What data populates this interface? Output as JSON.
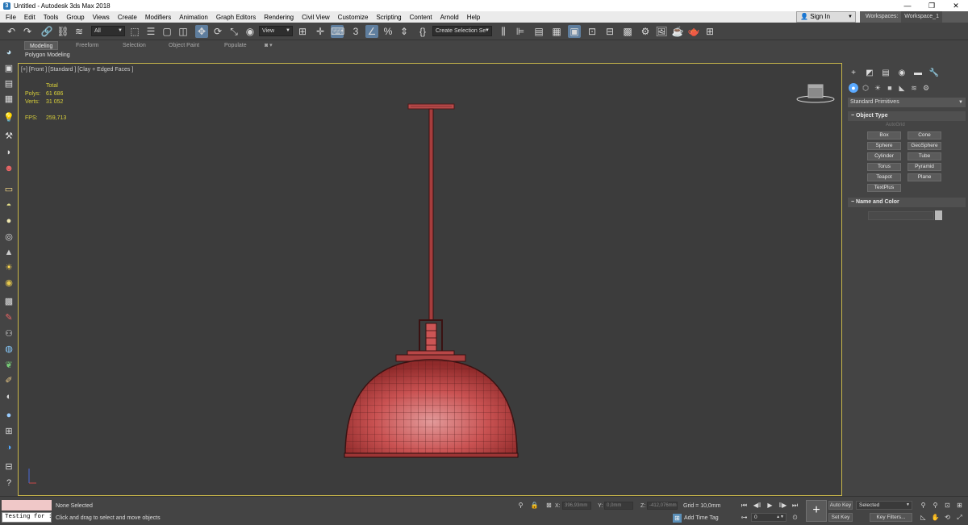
{
  "window": {
    "title": "Untitled - Autodesk 3ds Max 2018",
    "app_icon": "3ds-max-logo-icon",
    "controls": [
      "—",
      "❐",
      "✕"
    ]
  },
  "menubar": {
    "items": [
      "File",
      "Edit",
      "Tools",
      "Group",
      "Views",
      "Create",
      "Modifiers",
      "Animation",
      "Graph Editors",
      "Rendering",
      "Civil View",
      "Customize",
      "Scripting",
      "Content",
      "Arnold",
      "Help"
    ],
    "sign_in": "Sign In",
    "workspaces_label": "Workspaces:",
    "workspace_value": "Workspace_1"
  },
  "toolbar": {
    "selection_filter": "All",
    "reference_coord": "View",
    "named_selection": "Create Selection Se"
  },
  "ribbon": {
    "tabs": [
      "Modeling",
      "Freeform",
      "Selection",
      "Object Paint",
      "Populate"
    ],
    "active_tab": "Modeling",
    "sub_label": "Polygon Modeling"
  },
  "viewport": {
    "label": "[+] [Front ] [Standard ] [Clay + Edged Faces ]",
    "stats": {
      "total_label": "Total",
      "polys_label": "Polys:",
      "polys_value": "61 686",
      "verts_label": "Verts:",
      "verts_value": "31 052",
      "fps_label": "FPS:",
      "fps_value": "259,713"
    },
    "mesh_color": "#c04545",
    "border_color": "#c8b64a",
    "object": "pendant-lamp"
  },
  "command_panel": {
    "category": "Standard Primitives",
    "object_type_header": "Object Type",
    "autogrid_label": "AutoGrid",
    "buttons": [
      "Box",
      "Cone",
      "Sphere",
      "GeoSphere",
      "Cylinder",
      "Tube",
      "Torus",
      "Pyramid",
      "Teapot",
      "Plane",
      "TextPlus"
    ],
    "name_color_header": "Name and Color"
  },
  "statusbar": {
    "script_input": "Testing for :",
    "selection_status": "None Selected",
    "prompt": "Click and drag to select and move objects",
    "x_label": "X:",
    "x_value": "396,93mm",
    "y_label": "Y:",
    "y_value": "0,0mm",
    "z_label": "Z:",
    "z_value": "-412,076mm",
    "grid": "Grid = 10,0mm",
    "add_time_tag": "Add Time Tag",
    "auto_key": "Auto Key",
    "set_key": "Set Key",
    "key_mode": "Selected",
    "key_filters": "Key Filters...",
    "frame": "0"
  }
}
